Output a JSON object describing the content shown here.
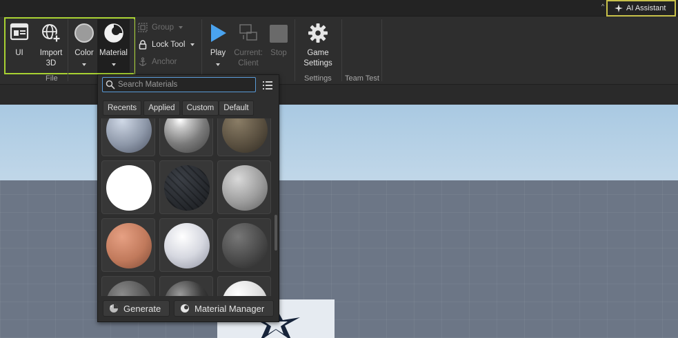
{
  "topbar": {
    "ai_assistant_label": "AI Assistant"
  },
  "ribbon": {
    "ui_label": "UI",
    "import3d_label_line1": "Import",
    "import3d_label_line2": "3D",
    "color_label": "Color",
    "material_label": "Material",
    "group_label": "Group",
    "lock_tool_label": "Lock Tool",
    "anchor_label": "Anchor",
    "play_label": "Play",
    "current_client_line1": "Current:",
    "current_client_line2": "Client",
    "stop_label": "Stop",
    "game_settings_line1": "Game",
    "game_settings_line2": "Settings",
    "sections": {
      "file": "File",
      "settings": "Settings",
      "team_test": "Team Test"
    }
  },
  "material_picker": {
    "search_placeholder": "Search Materials",
    "tabs": [
      "Recents",
      "Applied",
      "Custom",
      "Default"
    ],
    "generate_label": "Generate",
    "material_manager_label": "Material Manager"
  },
  "colors": {
    "highlight_green": "#a8d232",
    "highlight_yellow": "#c9c24a",
    "play_blue": "#4aa3ef",
    "search_border": "#5a9bd8"
  },
  "icons": [
    "ui-icon",
    "import-3d-icon",
    "color-swatch-icon",
    "material-icon",
    "group-icon",
    "lock-icon",
    "anchor-icon",
    "play-icon",
    "client-icon",
    "stop-icon",
    "gear-icon",
    "search-icon",
    "list-view-icon",
    "generate-icon",
    "material-manager-icon",
    "sparkle-icon"
  ]
}
